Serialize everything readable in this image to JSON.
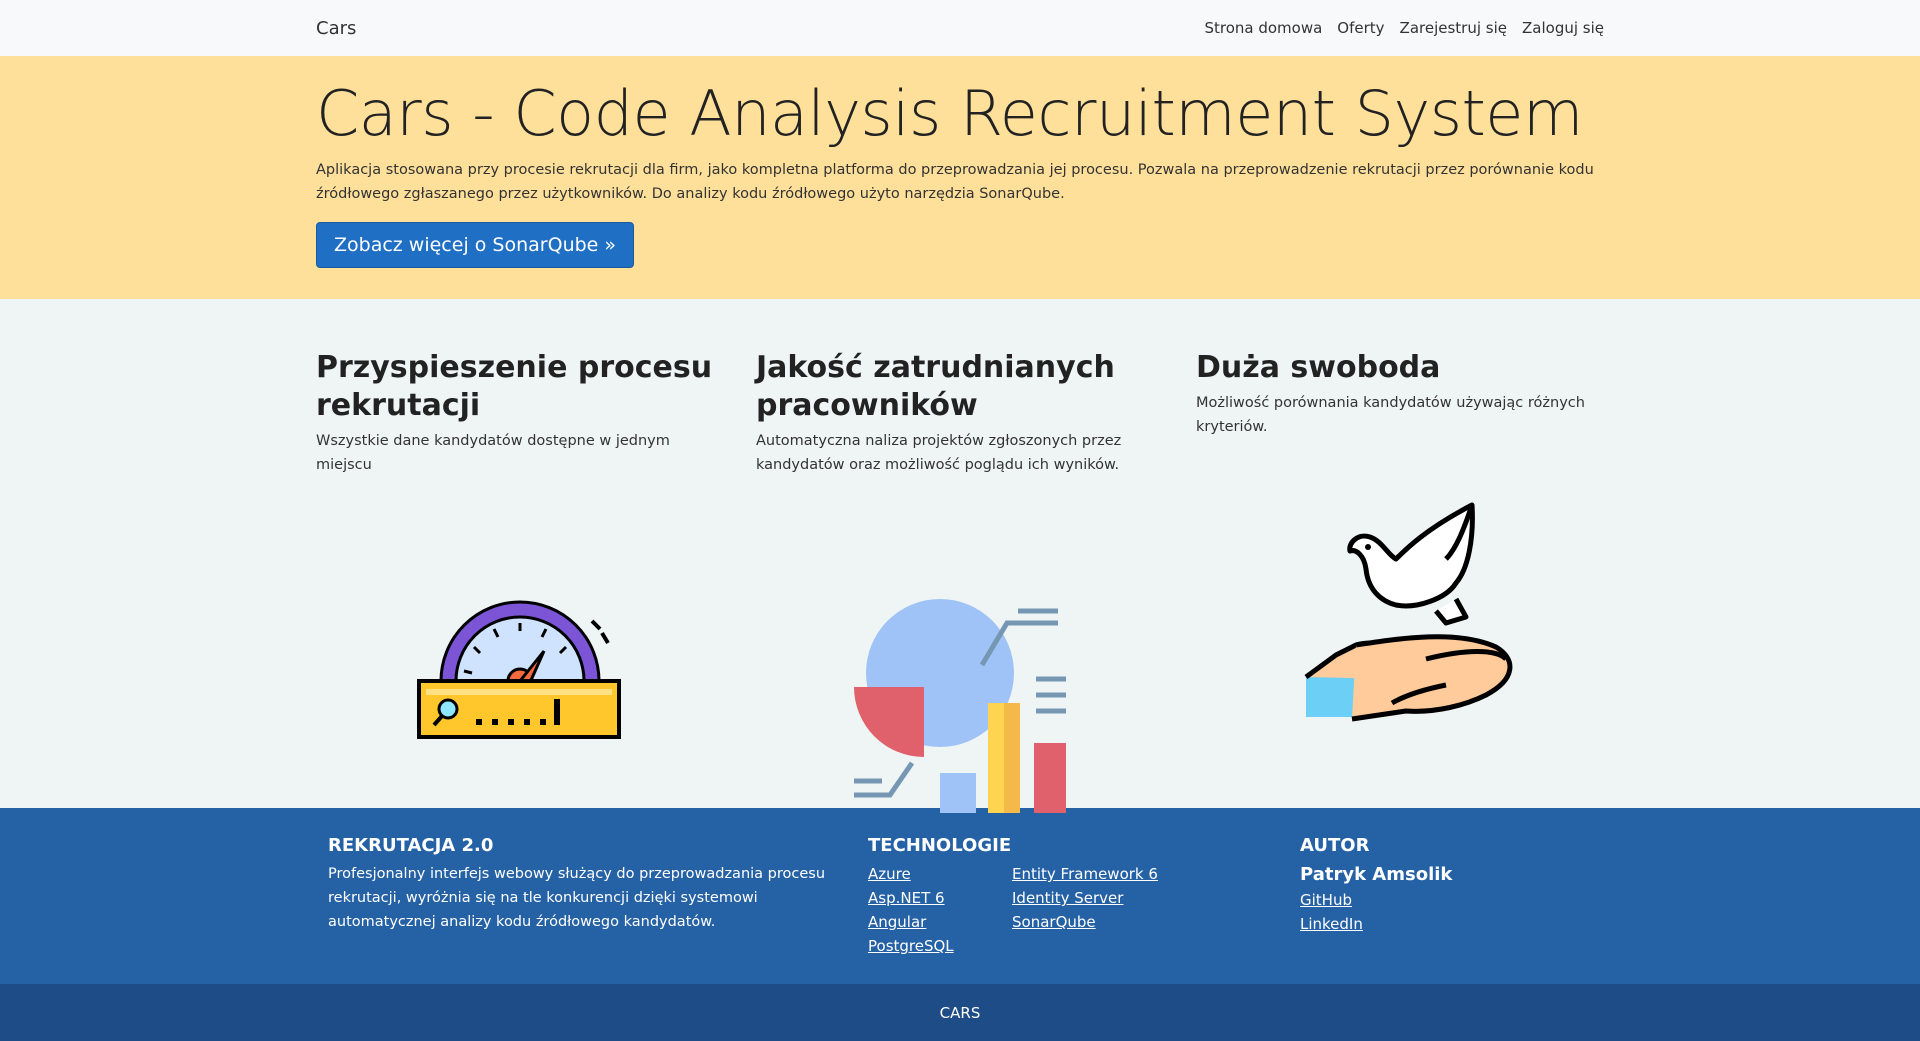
{
  "navbar": {
    "brand": "Cars",
    "links": [
      "Strona domowa",
      "Oferty",
      "Zarejestruj się",
      "Zaloguj się"
    ]
  },
  "hero": {
    "title": "Cars - Code Analysis Recruitment System",
    "text": "Aplikacja stosowana przy procesie rekrutacji dla firm, jako kompletna platforma do przeprowadzania jej procesu. Pozwala na przeprowadzenie rekrutacji przez porównanie kodu źródłowego zgłaszanego przez użytkowników. Do analizy kodu źródłowego użyto narzędzia SonarQube.",
    "button": "Zobacz więcej o SonarQube »"
  },
  "features": [
    {
      "title": "Przyspieszenie procesu rekrutacji",
      "text": "Wszystkie dane kandydatów dostępne w jednym miejscu",
      "icon": "speedometer-icon"
    },
    {
      "title": "Jakość zatrudnianych pracowników",
      "text": "Automatyczna naliza projektów zgłoszonych przez kandydatów oraz możliwość poglądu ich wyników.",
      "icon": "chart-icon"
    },
    {
      "title": "Duża swoboda",
      "text": "Możliwość porównania kandydatów używając różnych kryteriów.",
      "icon": "dove-hand-icon"
    }
  ],
  "footer": {
    "col1": {
      "title": "REKRUTACJA 2.0",
      "text": "Profesjonalny interfejs webowy służący do przeprowadzania procesu rekrutacji, wyróżnia się na tle konkurencji dzięki systemowi automatycznej analizy kodu źródłowego kandydatów."
    },
    "col2": {
      "title": "TECHNOLOGIE",
      "links_left": [
        "Azure",
        "Asp.NET 6",
        "Angular",
        "PostgreSQL"
      ],
      "links_right": [
        "Entity Framework 6",
        "Identity Server",
        "SonarQube"
      ]
    },
    "col3": {
      "title": "AUTOR",
      "name": "Patryk Amsolik",
      "links": [
        "GitHub",
        "LinkedIn"
      ]
    }
  },
  "bottom_bar": {
    "text": "CARS"
  },
  "colors": {
    "hero_bg": "#ffe09b",
    "button_bg": "#1f6fc5",
    "footer_bg": "#2561a5",
    "bottom_bar_bg": "#1d4c86"
  }
}
